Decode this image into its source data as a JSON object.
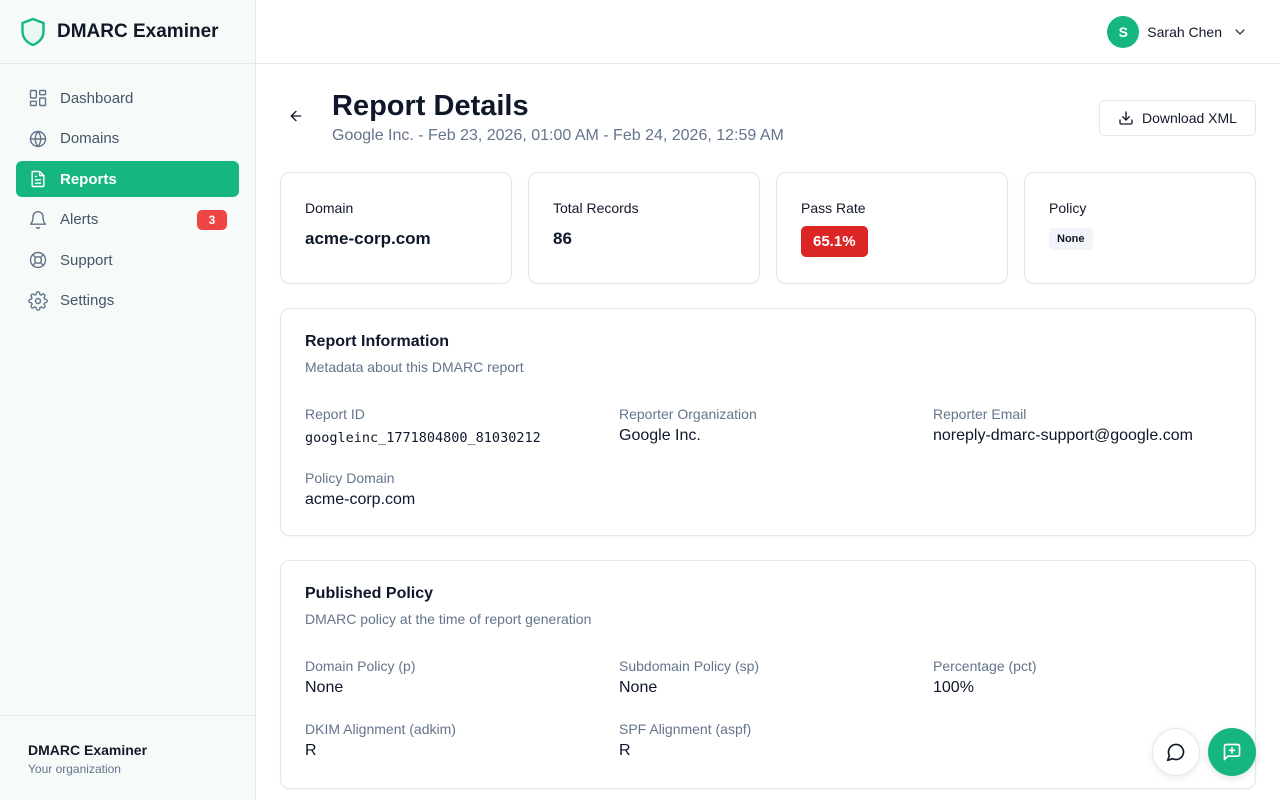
{
  "app": {
    "name": "DMARC Examiner"
  },
  "sidebar": {
    "items": [
      {
        "label": "Dashboard",
        "icon": "grid-icon"
      },
      {
        "label": "Domains",
        "icon": "globe-icon"
      },
      {
        "label": "Reports",
        "icon": "file-text-icon",
        "active": true
      },
      {
        "label": "Alerts",
        "icon": "bell-icon",
        "badge": "3"
      },
      {
        "label": "Support",
        "icon": "life-buoy-icon"
      },
      {
        "label": "Settings",
        "icon": "gear-icon"
      }
    ],
    "footer": {
      "title": "DMARC Examiner",
      "subtitle": "Your organization"
    }
  },
  "header": {
    "user": {
      "initial": "S",
      "name": "Sarah Chen"
    }
  },
  "page": {
    "title": "Report Details",
    "subtitle": "Google Inc. - Feb 23, 2026, 01:00 AM - Feb 24, 2026, 12:59 AM",
    "download_label": "Download XML"
  },
  "stats": {
    "domain": {
      "label": "Domain",
      "value": "acme-corp.com"
    },
    "total_records": {
      "label": "Total Records",
      "value": "86"
    },
    "pass_rate": {
      "label": "Pass Rate",
      "value": "65.1%"
    },
    "policy": {
      "label": "Policy",
      "value": "None"
    }
  },
  "report_info": {
    "title": "Report Information",
    "description": "Metadata about this DMARC report",
    "fields": {
      "report_id": {
        "label": "Report ID",
        "value": "googleinc_1771804800_81030212"
      },
      "reporter_org": {
        "label": "Reporter Organization",
        "value": "Google Inc."
      },
      "reporter_email": {
        "label": "Reporter Email",
        "value": "noreply-dmarc-support@google.com"
      },
      "policy_domain": {
        "label": "Policy Domain",
        "value": "acme-corp.com"
      }
    }
  },
  "published_policy": {
    "title": "Published Policy",
    "description": "DMARC policy at the time of report generation",
    "fields": {
      "p": {
        "label": "Domain Policy (p)",
        "value": "None"
      },
      "sp": {
        "label": "Subdomain Policy (sp)",
        "value": "None"
      },
      "pct": {
        "label": "Percentage (pct)",
        "value": "100%"
      },
      "adkim": {
        "label": "DKIM Alignment (adkim)",
        "value": "R"
      },
      "aspf": {
        "label": "SPF Alignment (aspf)",
        "value": "R"
      }
    }
  },
  "colors": {
    "accent": "#15b77e",
    "danger": "#dc2626",
    "badge": "#ef4444"
  }
}
